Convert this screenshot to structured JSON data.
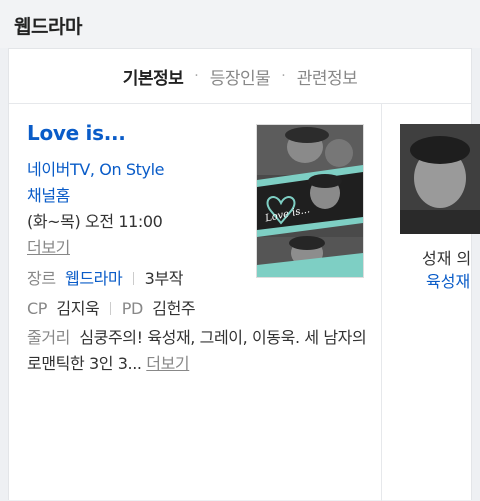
{
  "header": {
    "title": "웹드라마"
  },
  "tabs": [
    {
      "label": "기본정보",
      "active": true
    },
    {
      "label": "등장인물",
      "active": false
    },
    {
      "label": "관련정보",
      "active": false
    }
  ],
  "tab_separator": "·",
  "drama": {
    "title": "Love is...",
    "network": "네이버TV, On Style",
    "channel_home": "채널홈",
    "schedule": "(화~목) 오전 11:00",
    "more_label": "더보기",
    "genre_label": "장르",
    "genre_value": "웹드라마",
    "episodes": "3부작",
    "cp_label": "CP",
    "cp_value": "김지욱",
    "pd_label": "PD",
    "pd_value": "김헌주",
    "story_label": "줄거리",
    "story_text": "심쿵주의! 육성재, 그레이, 이동욱. 세 남자의 로맨틱한 3인 3...",
    "story_more": "더보기",
    "poster_text": "Love is..."
  },
  "side_card": {
    "caption": "성재 의",
    "link": "육성재"
  },
  "colors": {
    "accent": "#0a5cc8",
    "poster_teal": "#7ecfc4"
  }
}
